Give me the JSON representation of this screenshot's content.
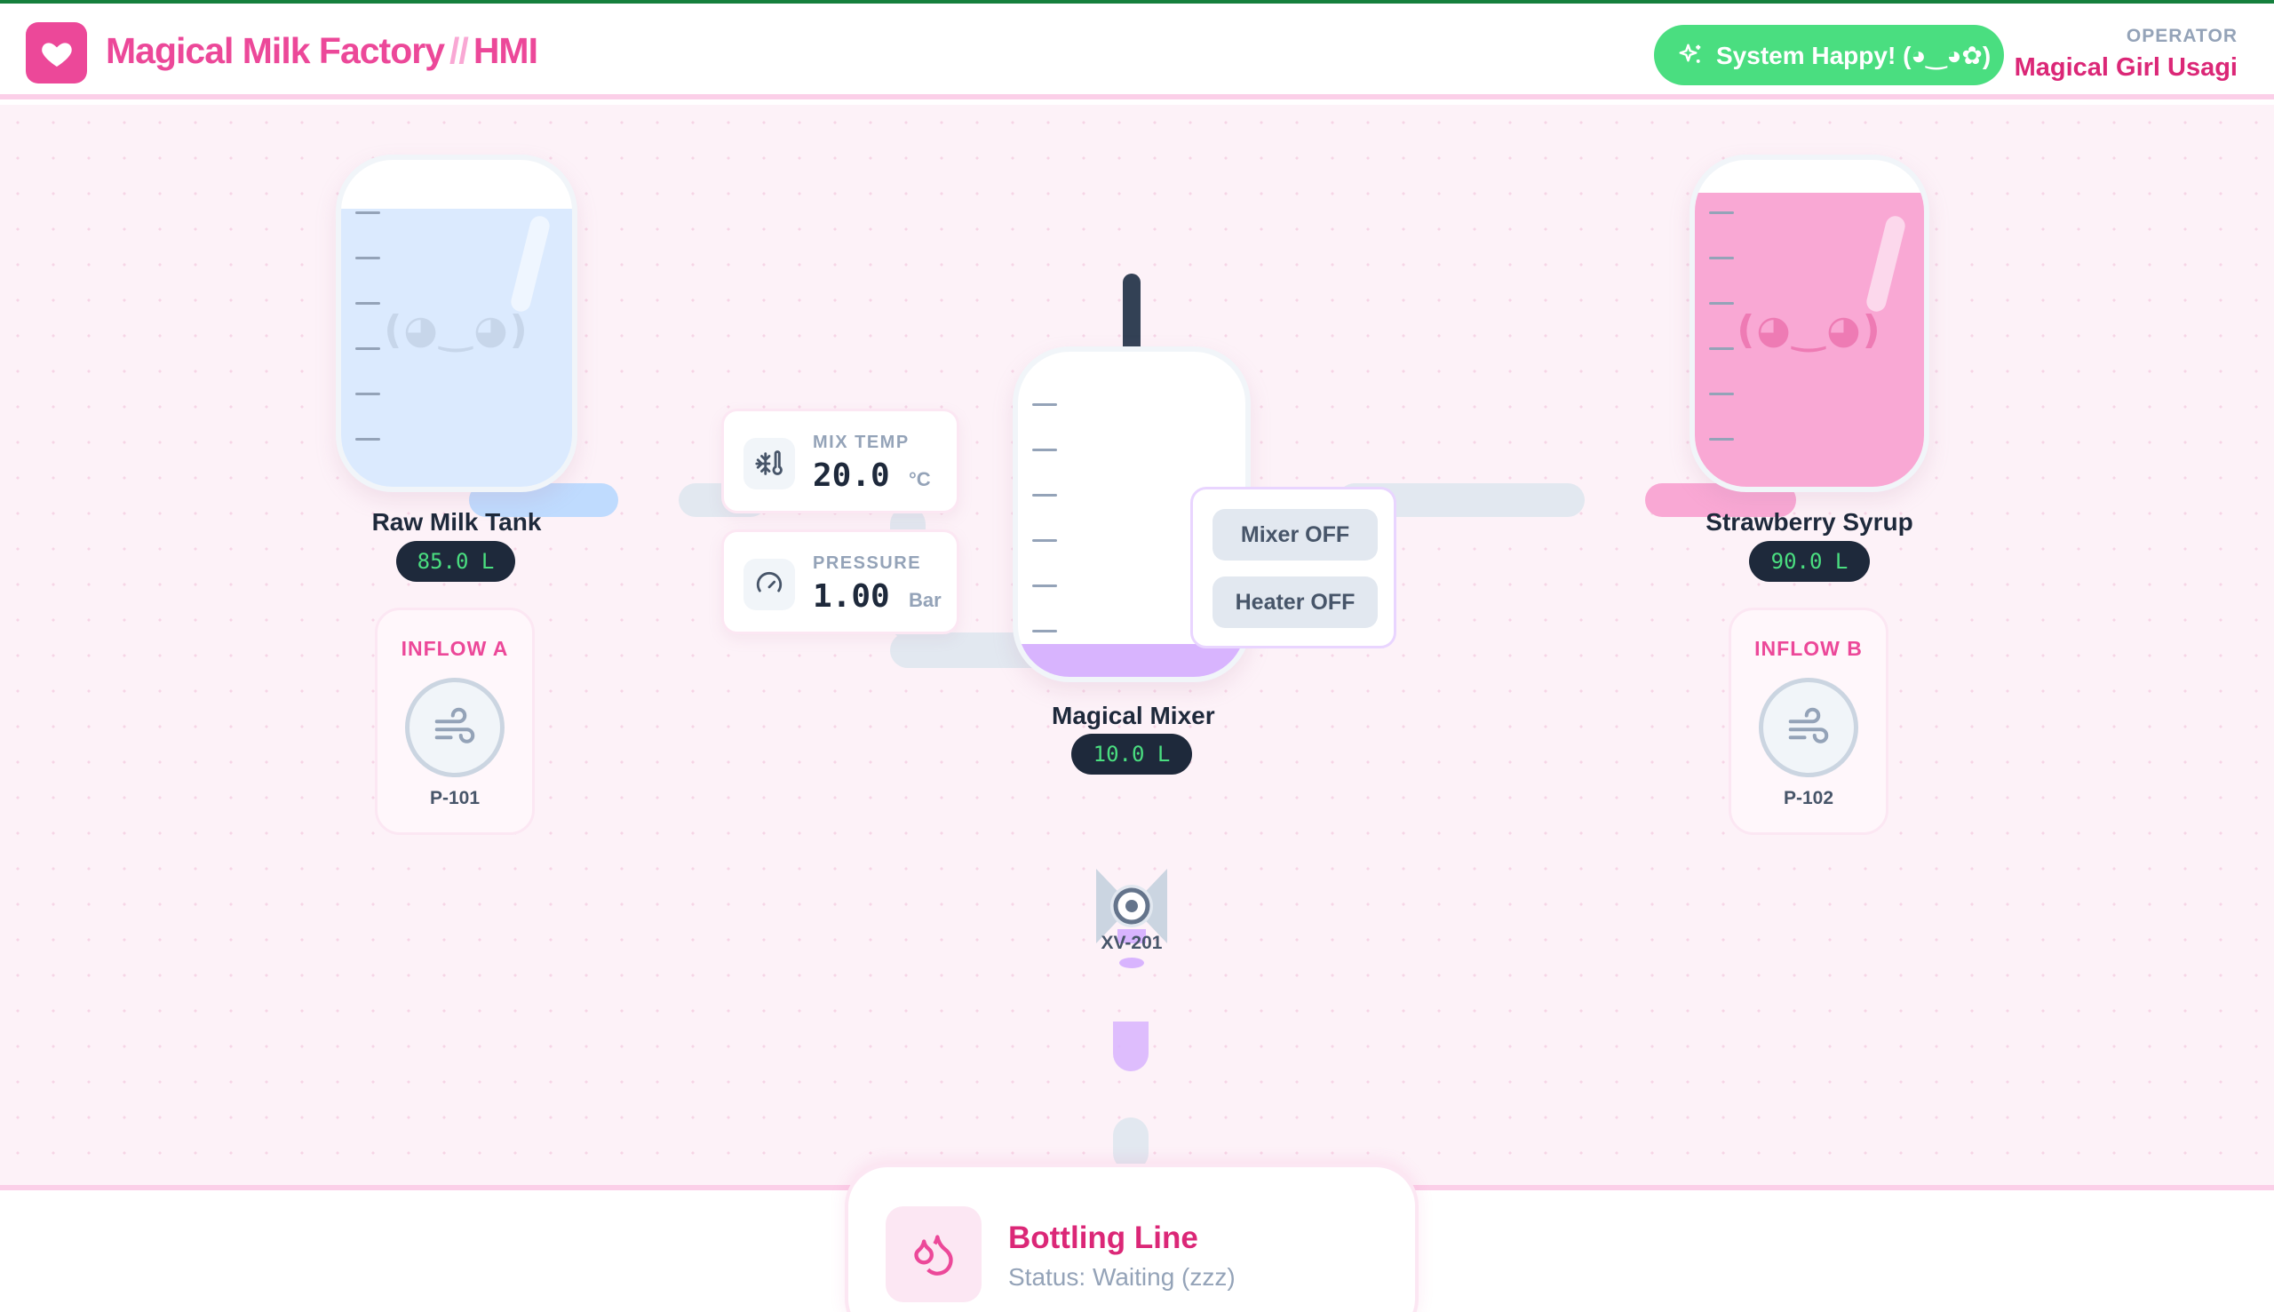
{
  "header": {
    "title": "Magical Milk Factory",
    "separator": "//",
    "title_suffix": "HMI",
    "system_status": "System Happy! (◕‿◕✿)",
    "operator_label": "OPERATOR",
    "operator_name": "Magical Girl Usagi",
    "logo_icon": "heart-icon",
    "status_icon": "sparkles-icon"
  },
  "colors": {
    "brand": "#ec4899",
    "status_ok": "#4ade80",
    "milk": "#dbeafe",
    "syrup": "#f9a8d4",
    "mix": "#d8b4fe",
    "readout_bg": "#1e293b",
    "readout_fg": "#4ade80"
  },
  "tanks": {
    "raw_milk": {
      "name": "Raw Milk Tank",
      "level_text": "85.0 L",
      "level_fraction": 0.85,
      "face": "(◕‿◕)"
    },
    "syrup": {
      "name": "Strawberry Syrup",
      "level_text": "90.0 L",
      "level_fraction": 0.9,
      "face": "(◕‿◕)"
    },
    "mixer": {
      "name": "Magical Mixer",
      "level_text": "10.0 L",
      "level_fraction": 0.1
    }
  },
  "inflows": {
    "a": {
      "label": "INFLOW A",
      "pump_tag": "P-101",
      "icon": "wind-icon"
    },
    "b": {
      "label": "INFLOW B",
      "pump_tag": "P-102",
      "icon": "wind-icon"
    }
  },
  "sensors": {
    "temp": {
      "label": "MIX TEMP",
      "value": "20.0",
      "unit": "°C",
      "icon": "thermometer-snowflake-icon"
    },
    "pressure": {
      "label": "PRESSURE",
      "value": "1.00",
      "unit": "Bar",
      "icon": "gauge-icon"
    }
  },
  "controls": {
    "mixer": "Mixer OFF",
    "heater": "Heater OFF"
  },
  "valve": {
    "tag": "XV-201",
    "icon": "valve-icon"
  },
  "bottling": {
    "title": "Bottling Line",
    "status": "Status: Waiting (zzz)",
    "icon": "droplets-icon"
  }
}
